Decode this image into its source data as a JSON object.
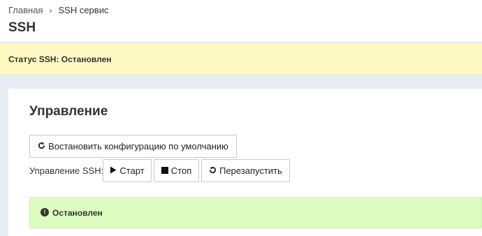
{
  "breadcrumb": {
    "home": "Главная",
    "separator_icon": "chevron-right-icon",
    "current": "SSH сервис"
  },
  "page": {
    "title": "SSH"
  },
  "status_bar": {
    "text": "Статус SSH: Остановлен"
  },
  "management": {
    "title": "Управление",
    "reset_button": {
      "icon": "refresh-icon",
      "label": "Востановить конфигурацию по умолчанию"
    },
    "ssh_label": "Управление SSH:",
    "start_button": {
      "icon": "play-icon",
      "label": "Старт"
    },
    "stop_button": {
      "icon": "stop-icon",
      "label": "Стоп"
    },
    "restart_button": {
      "icon": "undo-icon",
      "label": "Перезапустить"
    }
  },
  "alert": {
    "icon": "exclamation-circle-icon",
    "text": "Остановлен"
  },
  "colors": {
    "status_bar_bg": "#fef9c3",
    "alert_bg": "#dcfcc0",
    "page_bg": "#e8edf5"
  }
}
